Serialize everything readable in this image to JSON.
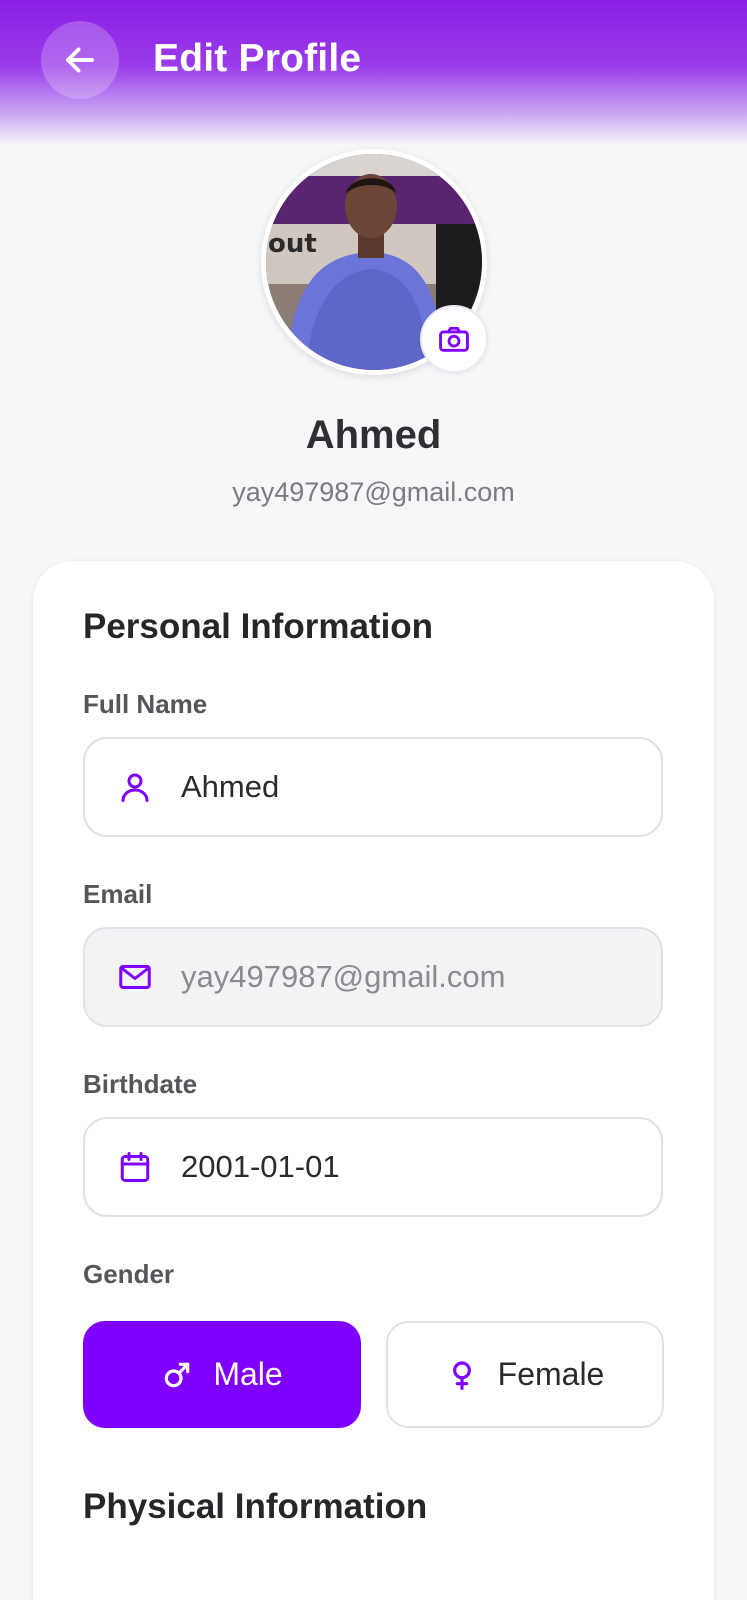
{
  "header": {
    "title": "Edit Profile",
    "back_icon": "arrow-left-icon"
  },
  "profile": {
    "name": "Ahmed",
    "email": "yay497987@gmail.com",
    "camera_icon": "camera-icon"
  },
  "personal": {
    "section_title": "Personal Information",
    "full_name": {
      "label": "Full Name",
      "value": "Ahmed",
      "icon": "user-icon"
    },
    "email": {
      "label": "Email",
      "value": "yay497987@gmail.com",
      "icon": "mail-icon"
    },
    "birthdate": {
      "label": "Birthdate",
      "value": "2001-01-01",
      "icon": "calendar-icon"
    },
    "gender": {
      "label": "Gender",
      "selected": "Male",
      "options": [
        {
          "label": "Male",
          "icon": "male-symbol-icon"
        },
        {
          "label": "Female",
          "icon": "female-symbol-icon"
        }
      ]
    }
  },
  "physical": {
    "section_title": "Physical Information"
  },
  "colors": {
    "accent": "#7f00ff",
    "header_gradient_top": "#8a1ee6",
    "background": "#f6f7f9"
  }
}
